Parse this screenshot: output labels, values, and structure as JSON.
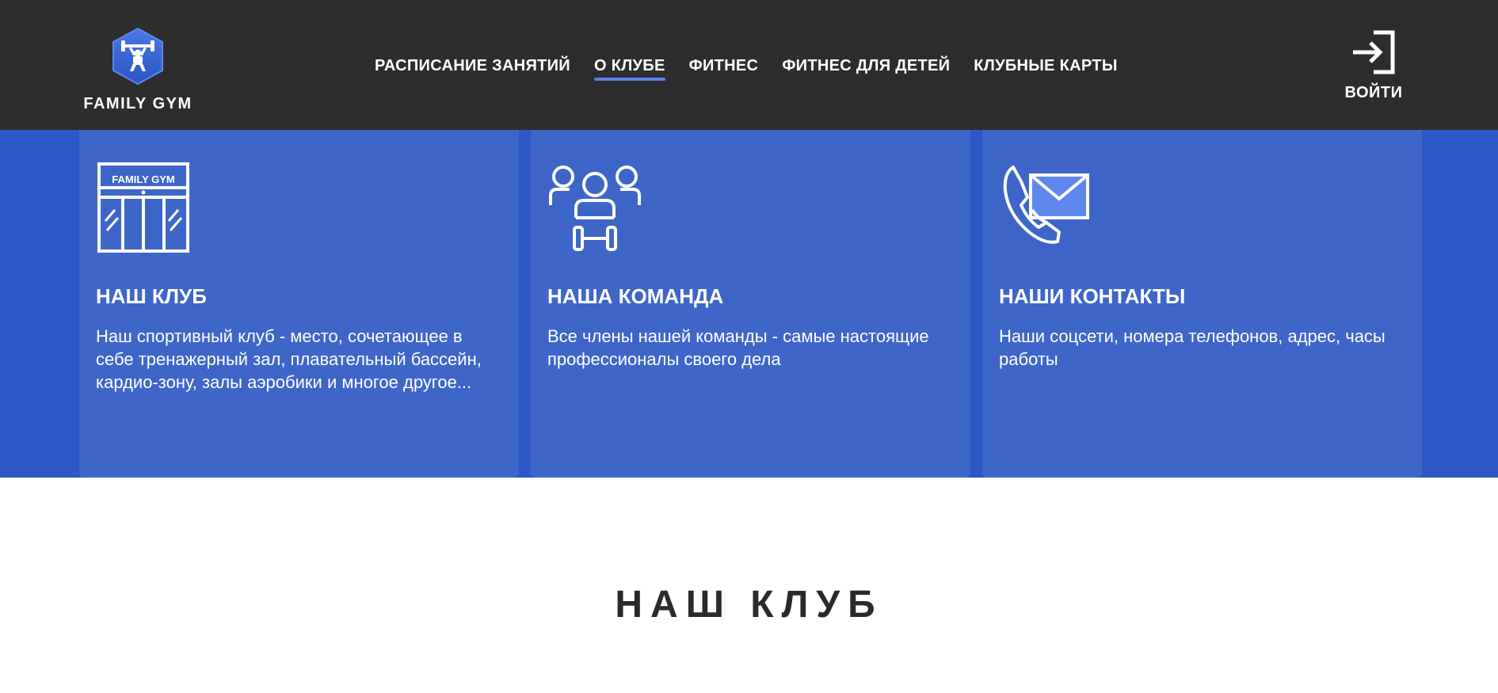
{
  "brand": {
    "name": "FAMILY GYM",
    "logo_icon": "weightlifter-hexagon-icon",
    "accent": "#3b6ad9"
  },
  "nav": {
    "items": [
      {
        "label": "РАСПИСАНИЕ ЗАНЯТИЙ",
        "active": false
      },
      {
        "label": "О КЛУБЕ",
        "active": true
      },
      {
        "label": "ФИТНЕС",
        "active": false
      },
      {
        "label": "ФИТНЕС ДЛЯ ДЕТЕЙ",
        "active": false
      },
      {
        "label": "КЛУБНЫЕ КАРТЫ",
        "active": false
      }
    ]
  },
  "login": {
    "label": "ВОЙТИ",
    "icon": "login-arrow-icon"
  },
  "cards": [
    {
      "icon": "gym-building-icon",
      "icon_sign": "FAMILY GYM",
      "title": "НАШ КЛУБ",
      "text": "Наш спортивный клуб - место, сочетающее в себе тренажерный зал, плавательный бассейн, кардио-зону, залы аэробики и многое другое..."
    },
    {
      "icon": "team-people-icon",
      "title": "НАША КОМАНДА",
      "text": "Все члены нашей команды - самые настоящие профессионалы своего дела"
    },
    {
      "icon": "phone-mail-icon",
      "title": "НАШИ КОНТАКТЫ",
      "text": "Наши соцсети, номера телефонов, адрес, часы работы"
    }
  ],
  "section": {
    "title": "НАШ КЛУБ"
  },
  "colors": {
    "header_bg": "#2d2d2d",
    "band_bg": "#2d57c7",
    "card_bg": "#3d66c8",
    "active_underline": "#5a80e8"
  }
}
